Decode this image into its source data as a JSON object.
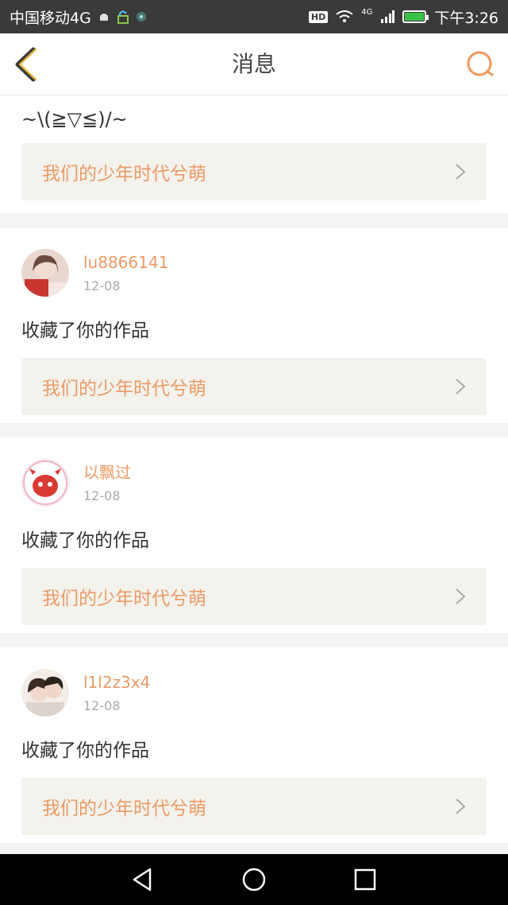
{
  "status": {
    "carrier": "中国移动4G",
    "hd": "HD",
    "net_type": "4G",
    "time": "下午3:26"
  },
  "header": {
    "title": "消息"
  },
  "first_item": {
    "text": "~\\(≧▽≦)/~",
    "work_title": "我们的少年时代兮萌"
  },
  "items": [
    {
      "username": "lu8866141",
      "date": "12-08",
      "action": "收藏了你的作品",
      "work_title": "我们的少年时代兮萌",
      "avatar_color": "#c9362f"
    },
    {
      "username": "以飘过",
      "date": "12-08",
      "action": "收藏了你的作品",
      "work_title": "我们的少年时代兮萌",
      "avatar_color": "#f7d3de"
    },
    {
      "username": "l1l2z3x4",
      "date": "12-08",
      "action": "收藏了你的作品",
      "work_title": "我们的少年时代兮萌",
      "avatar_color": "#6b5a50"
    }
  ],
  "colors": {
    "accent": "#ec9a65",
    "link_bg": "#f3f2ec",
    "back_icon": "#c59a2c",
    "search_icon": "#ef9a5e"
  },
  "icons": [
    "back-icon",
    "search-icon",
    "chevron-right-icon",
    "nav-back-icon",
    "nav-home-icon",
    "nav-recent-icon"
  ]
}
